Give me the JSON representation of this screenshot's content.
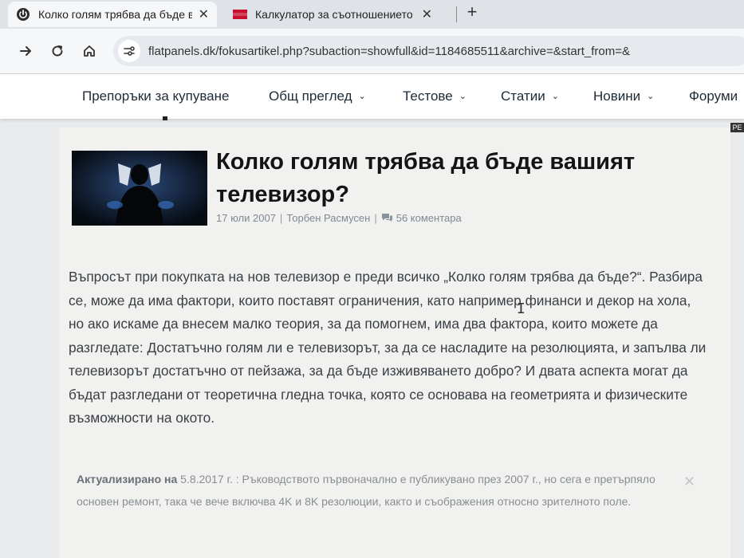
{
  "browser": {
    "tabs": [
      {
        "title": "Колко голям трябва да бъде в",
        "active": true,
        "icon": "power-icon"
      },
      {
        "title": "Калкулатор за съотношението",
        "active": false,
        "icon": "flag-icon"
      }
    ],
    "close_glyph": "✕",
    "new_tab_glyph": "+",
    "url": "flatpanels.dk/fokusartikel.php?subaction=showfull&id=1184685511&archive=&start_from=&"
  },
  "nav": {
    "items": [
      {
        "label": "Препоръки за купуване",
        "has_dropdown": false
      },
      {
        "label": "Общ преглед",
        "has_dropdown": true
      },
      {
        "label": "Тестове",
        "has_dropdown": true
      },
      {
        "label": "Статии",
        "has_dropdown": true
      },
      {
        "label": "Новини",
        "has_dropdown": true
      },
      {
        "label": "Форуми",
        "has_dropdown": false
      }
    ],
    "chevron": "⌄"
  },
  "badge_text": "РЕ",
  "article": {
    "title": "Колко голям трябва да бъде вашият телевизор?",
    "date": "17 юли 2007",
    "author": "Торбен Расмусен",
    "comments": "56 коментара",
    "intro": "Въпросът при покупката на нов телевизор е преди всичко „Колко голям трябва да бъде?“. Разбира се, може да има фактори, които поставят ограничения, като например финанси и декор на хола, но ако искаме да внесем малко теория, за да помогнем, има два фактора, които можете да разгледате: Достатъчно голям ли е телевизорът, за да се насладите на резолюцията, и запълва ли телевизорът достатъчно от пейзажа, за да бъде изживяването добро? И двата аспекта могат да бъдат разгледани от теоретична гледна точка, която се основава на геометрията и физическите възможности на окото.",
    "update_label": "Актуализирано на",
    "update_date": "5.8.2017 г.",
    "update_text": ": Ръководството първоначално е публикувано през 2007 г., но сега е претърпяло основен ремонт, така че вече включва 4K и 8K резолюции, както и съображения относно зрителното поле.",
    "update_close": "✕"
  },
  "colors": {
    "accent": "#3b6aa0",
    "chrome": "#dfe3e8",
    "article_bg": "#f1f1f0"
  }
}
